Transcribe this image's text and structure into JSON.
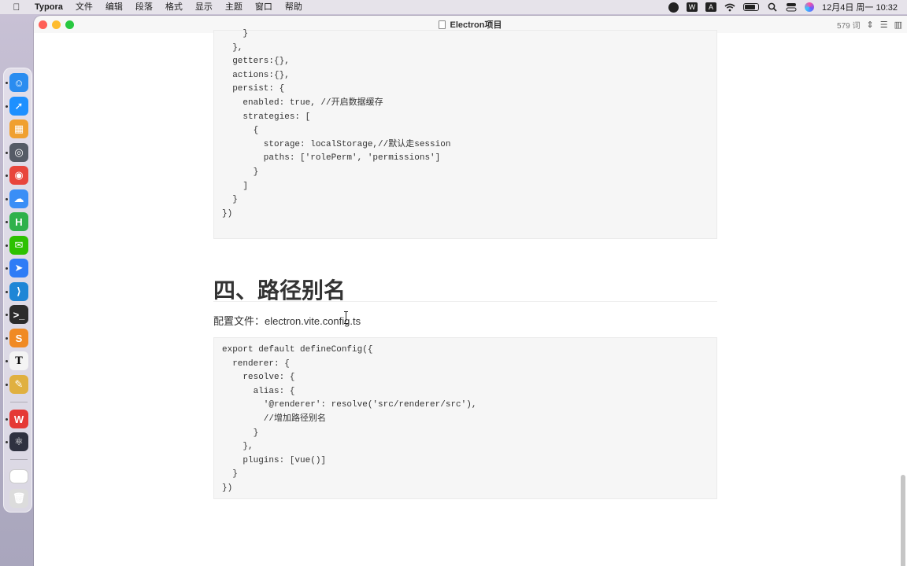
{
  "menubar": {
    "app": "Typora",
    "items": [
      "文件",
      "编辑",
      "段落",
      "格式",
      "显示",
      "主题",
      "窗口",
      "帮助"
    ],
    "clock": "12月4日 周一  10:32",
    "status_icons": [
      "stop-record-icon",
      "wps-icon",
      "input-method-icon",
      "wifi-icon",
      "battery-icon",
      "spotlight-icon",
      "control-center-icon",
      "siri-icon"
    ],
    "input_method_label": "A",
    "wps_label": "W"
  },
  "window": {
    "title": "Electron项目",
    "word_count": "579 词",
    "word_count_arrow": "⌃",
    "colors": {
      "close": "#ff5f57",
      "minimize": "#febc2e",
      "maximize": "#28c840"
    }
  },
  "document": {
    "code_block_1": [
      "    }",
      "  },",
      "  getters:{},",
      "  actions:{},",
      "  persist: {",
      "    enabled: true, //开启数据缓存",
      "    strategies: [",
      "      {",
      "        storage: localStorage,//默认走session",
      "        paths: ['rolePerm', 'permissions']",
      "      }",
      "    ]",
      "  }",
      "})"
    ],
    "heading": "四、路径别名",
    "paragraph": "配置文件：electron.vite.config.ts",
    "code_block_2": [
      "export default defineConfig({",
      "  renderer: {",
      "    resolve: {",
      "      alias: {",
      "        '@renderer': resolve('src/renderer/src'),",
      "        //增加路径别名",
      "      }",
      "    },",
      "    plugins: [vue()]",
      "  }",
      "})"
    ]
  },
  "dock": {
    "apps": [
      {
        "name": "finder-icon",
        "glyph": "☺",
        "color": "#2a8cf0"
      },
      {
        "name": "safari-icon",
        "glyph": "➚",
        "color": "#1e90ff"
      },
      {
        "name": "launchpad-icon",
        "glyph": "▦",
        "color": "#f0a030"
      },
      {
        "name": "screenshot-icon",
        "glyph": "◎",
        "color": "#555b66"
      },
      {
        "name": "chrome-icon",
        "glyph": "◉",
        "color": "#e8453c"
      },
      {
        "name": "baidu-netdisk-icon",
        "glyph": "☁",
        "color": "#3a8ef6"
      },
      {
        "name": "hbuilder-icon",
        "glyph": "H",
        "color": "#2fb14b"
      },
      {
        "name": "wechat-icon",
        "glyph": "✉",
        "color": "#2dc100"
      },
      {
        "name": "feishu-icon",
        "glyph": "➤",
        "color": "#2f7cf6"
      },
      {
        "name": "vscode-icon",
        "glyph": "⟩",
        "color": "#1f86d6"
      },
      {
        "name": "terminal-icon",
        "glyph": ">_",
        "color": "#2b2b2b"
      },
      {
        "name": "sublime-icon",
        "glyph": "S",
        "color": "#f08a24"
      },
      {
        "name": "typora-icon",
        "glyph": "T",
        "color": "#f4f4f4"
      },
      {
        "name": "paint-icon",
        "glyph": "✎",
        "color": "#e0b040"
      },
      {
        "name": "wps-office-icon",
        "glyph": "W",
        "color": "#e53935"
      },
      {
        "name": "electron-icon",
        "glyph": "⚛",
        "color": "#2f3240"
      },
      {
        "name": "downloads-stack-icon",
        "glyph": "",
        "color": "#ffffff"
      },
      {
        "name": "trash-icon",
        "glyph": "🗑",
        "color": "#dcdcdc"
      }
    ]
  }
}
